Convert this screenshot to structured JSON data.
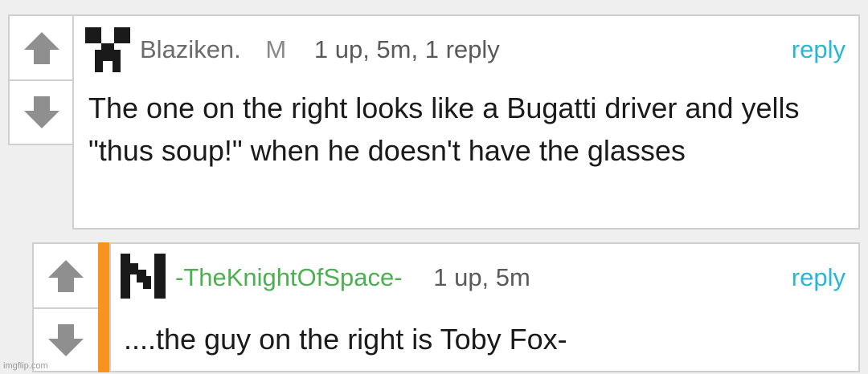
{
  "comments": [
    {
      "username": "Blaziken.",
      "mod_badge": "M",
      "meta": "1 up, 5m, 1 reply",
      "reply_label": "reply",
      "text": "The one on the right looks like a Bugatti driver and yells \"thus soup!\" when he doesn't have the glasses",
      "avatar_icon": "creeper-face-icon"
    },
    {
      "username": "-TheKnightOfSpace-",
      "meta": "1 up, 5m",
      "reply_label": "reply",
      "text": "....the guy on the right is Toby Fox-",
      "avatar_icon": "pixel-n-icon",
      "username_color": "#4caf50",
      "reply_indicator_color": "#f7931e"
    }
  ],
  "watermark": "imgflip.com",
  "colors": {
    "reply": "#29b6d6",
    "arrow": "#8f8f8f",
    "border": "#cfcfcf"
  }
}
